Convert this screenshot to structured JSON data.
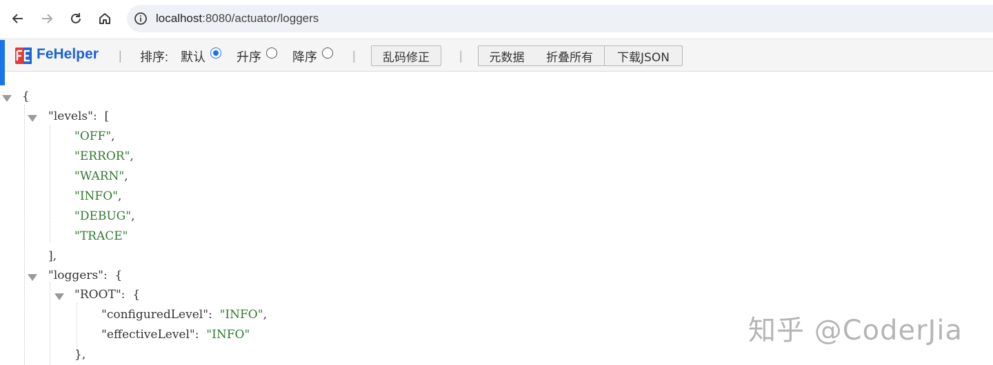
{
  "browser": {
    "url": "localhost:8080/actuator/loggers",
    "url_prefix": "localhost",
    "url_rest": ":8080/actuator/loggers"
  },
  "fehelper": {
    "title": "FeHelper",
    "sort_label": "排序:",
    "sort_default": "默认",
    "sort_asc": "升序",
    "sort_desc": "降序",
    "sort_selected": "默认",
    "fix_encoding": "乱码修正",
    "metadata": "元数据",
    "collapse_all": "折叠所有",
    "download_json": "下载JSON",
    "separator": "|"
  },
  "json": {
    "open_brace": "{",
    "levels_key": "\"levels\"",
    "levels": [
      "\"OFF\"",
      "\"ERROR\"",
      "\"WARN\"",
      "\"INFO\"",
      "\"DEBUG\"",
      "\"TRACE\""
    ],
    "levels_close": "],",
    "loggers_key": "\"loggers\"",
    "root_key": "\"ROOT\"",
    "configured_key": "\"configuredLevel\"",
    "configured_val": "\"INFO\"",
    "effective_key": "\"effectiveLevel\"",
    "effective_val": "\"INFO\"",
    "root_close": "},"
  },
  "watermark": "知乎 @CoderJia"
}
